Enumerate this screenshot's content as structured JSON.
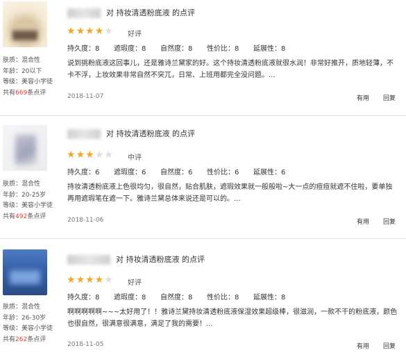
{
  "reviews": [
    {
      "title_pre": "对 ",
      "product": "持妆清透粉底液",
      "title_post": " 的点评",
      "stars": 4,
      "rating_label": "好评",
      "scores": {
        "durability": {
          "label": "持久度",
          "value": "8"
        },
        "coverage": {
          "label": "遮瑕度",
          "value": "8"
        },
        "natural": {
          "label": "自然度",
          "value": "8"
        },
        "value": {
          "label": "性价比",
          "value": "8"
        },
        "spread": {
          "label": "延展性",
          "value": "8"
        }
      },
      "content": "说到挑粉底液这回事儿，还是雅诗兰黛家的好。这个持妆清透粉底液就很水润！非常好推开，质地轻薄，不卡不浮，上妆效果非常自然不突兀，日常、上班用都完全没问题。...",
      "skin_label": "肤质：",
      "skin": "混合性",
      "age_label": "年龄：",
      "age": "20以下",
      "level_label": "等级：",
      "level": "美容小学徒",
      "count_pre": "共有",
      "count": "669",
      "count_post": "条点评",
      "date": "2018-11-07",
      "useful": "有用",
      "reply": "回复"
    },
    {
      "title_pre": "对 ",
      "product": "持妆清透粉底液",
      "title_post": " 的点评",
      "stars": 3,
      "rating_label": "中评",
      "scores": {
        "durability": {
          "label": "持久度",
          "value": "6"
        },
        "coverage": {
          "label": "遮瑕度",
          "value": "6"
        },
        "natural": {
          "label": "自然度",
          "value": "6"
        },
        "value": {
          "label": "性价比",
          "value": "6"
        },
        "spread": {
          "label": "延展性",
          "value": "6"
        }
      },
      "content": "持妆清透粉底液上色很均匀，很自然，贴合肌肤，遮瑕效果就一般般啦~大一点的痘痘就遮不住啦，要单独再用遮瑕笔在遮一下。雅诗兰黛总体来说还是可以的。...",
      "skin_label": "肤质：",
      "skin": "混合性",
      "age_label": "年龄：",
      "age": "20-25岁",
      "level_label": "等级：",
      "level": "美容小学徒",
      "count_pre": "共有",
      "count": "492",
      "count_post": "条点评",
      "date": "2018-11-06",
      "useful": "有用",
      "reply": "回复"
    },
    {
      "title_pre": "对 ",
      "product": "持妆清透粉底液",
      "title_post": " 的点评",
      "stars": 4,
      "rating_label": "好评",
      "scores": {
        "durability": {
          "label": "持久度",
          "value": "8"
        },
        "coverage": {
          "label": "遮瑕度",
          "value": "8"
        },
        "natural": {
          "label": "自然度",
          "value": "8"
        },
        "value": {
          "label": "性价比",
          "value": "8"
        },
        "spread": {
          "label": "延展性",
          "value": "8"
        }
      },
      "content": "啊啊啊啊啊~~~太好用了！！雅诗兰黛持妆清透粉底液保湿效果超级棒，很滋润，一款不干的粉底液，颜色也很自然，很满意很满意，满足了我的需要！...",
      "skin_label": "肤质：",
      "skin": "混合性",
      "age_label": "年龄：",
      "age": "26-30岁",
      "level_label": "等级：",
      "level": "美容小学徒",
      "count_pre": "共有",
      "count": "262",
      "count_post": "条点评",
      "date": "2018-11-05",
      "useful": "有用",
      "reply": "回复"
    }
  ],
  "colors": {
    "star": "#f5a623",
    "count": "#e03b3b"
  }
}
